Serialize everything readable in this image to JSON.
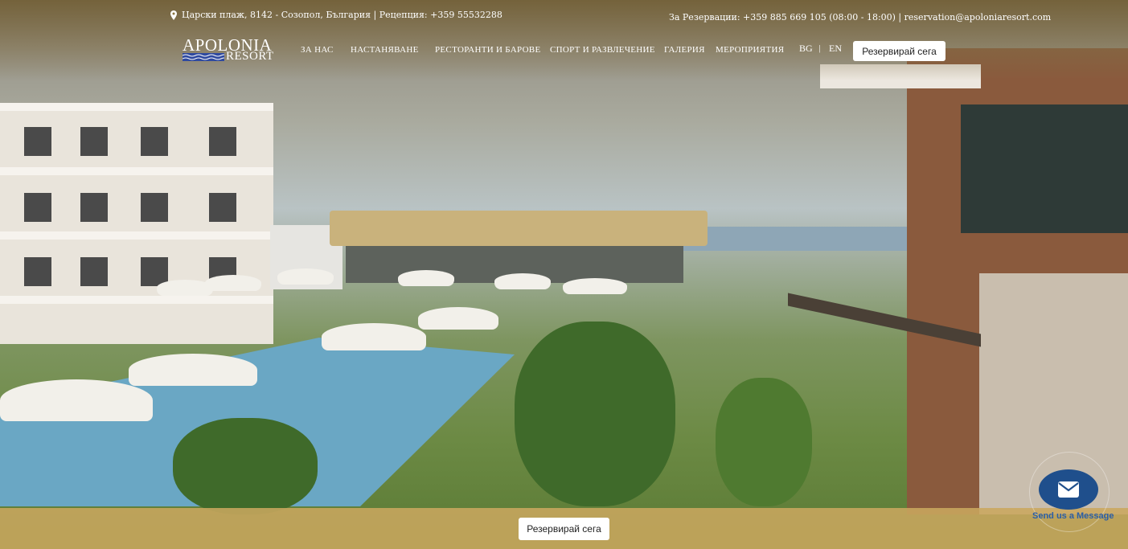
{
  "topbar": {
    "address": "Царски плаж, 8142 - Созопол, България | Рецепция: +359 55532288",
    "reservations": "За Резервации: +359 885 669 105 (08:00 - 18:00) | reservation@apoloniaresort.com"
  },
  "logo": {
    "top": "APOLONIA",
    "bottom": "RESORT"
  },
  "nav": {
    "items": [
      {
        "label": "ЗА НАС"
      },
      {
        "label": "НАСТАНЯВАНЕ"
      },
      {
        "label": "РЕСТОРАНТИ И БАРОВЕ"
      },
      {
        "label": "СПОРТ И РАЗВЛЕЧЕНИЕ"
      },
      {
        "label": "ГАЛЕРИЯ"
      },
      {
        "label": "МЕРОПРИЯТИЯ"
      }
    ],
    "lang_bg": "BG",
    "lang_sep": "|",
    "lang_en": "EN",
    "book_label": "Резервирай сега"
  },
  "footer": {
    "book_label": "Резервирай сега"
  },
  "chat": {
    "label": "Send us a Message",
    "icon": "envelope-icon"
  },
  "colors": {
    "accent": "#c9a75f",
    "chat": "#1f4f8c",
    "logo_waves": "#2f4aa0"
  }
}
